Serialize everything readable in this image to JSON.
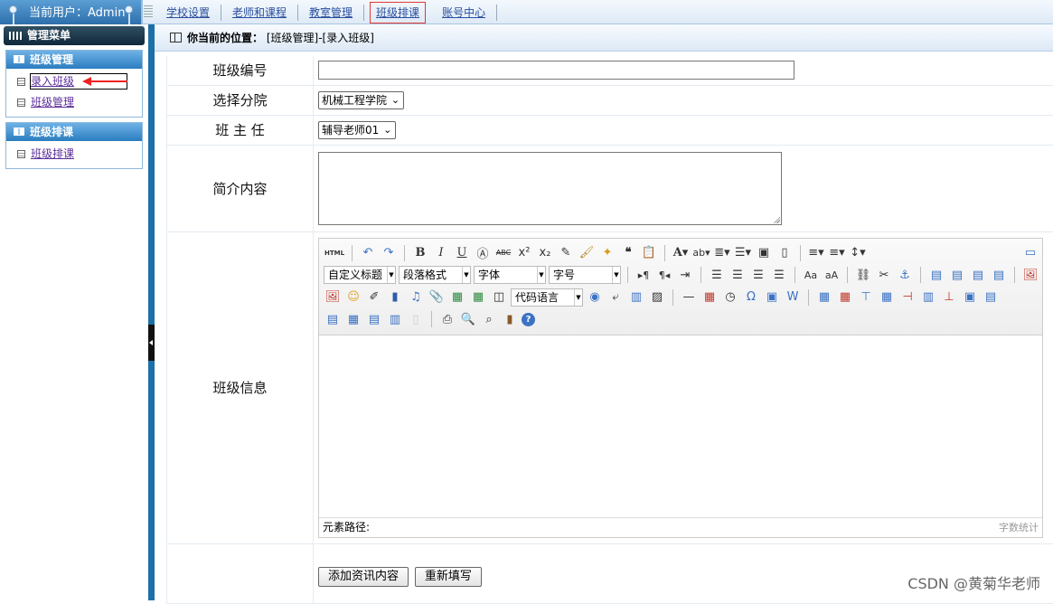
{
  "header": {
    "user_label": "当前用户：Admin",
    "nav": [
      {
        "label": "学校设置"
      },
      {
        "label": "老师和课程"
      },
      {
        "label": "教室管理"
      },
      {
        "label": "班级排课",
        "active": true
      },
      {
        "label": "账号中心"
      }
    ]
  },
  "sidebar": {
    "menu_title": "管理菜单",
    "groups": [
      {
        "title": "班级管理",
        "items": [
          {
            "label": "录入班级",
            "selected": true
          },
          {
            "label": "班级管理"
          }
        ]
      },
      {
        "title": "班级排课",
        "items": [
          {
            "label": "班级排课"
          }
        ]
      }
    ]
  },
  "location": {
    "prefix": "你当前的位置：",
    "path": "[班级管理]-[录入班级]"
  },
  "form": {
    "class_number_label": "班级编号",
    "class_number_value": "",
    "college_label": "选择分院",
    "college_value": "机械工程学院",
    "head_teacher_label": "班 主 任",
    "head_teacher_value": "辅导老师01",
    "intro_label": "简介内容",
    "intro_value": "",
    "info_label": "班级信息",
    "submit_label": "添加资讯内容",
    "reset_label": "重新填写"
  },
  "editor": {
    "combos": {
      "heading": "自定义标题",
      "paragraph": "段落格式",
      "font": "字体",
      "size": "字号",
      "code": "代码语言"
    },
    "element_path": "元素路径:",
    "word_count": "字数统计"
  },
  "watermark": "CSDN @黄菊华老师",
  "colors": {
    "sidebar_header": "#2b7dc0",
    "splitter": "#1d6fa8",
    "nav_active_border": "#e03a3a",
    "link": "#2a4f9e"
  }
}
